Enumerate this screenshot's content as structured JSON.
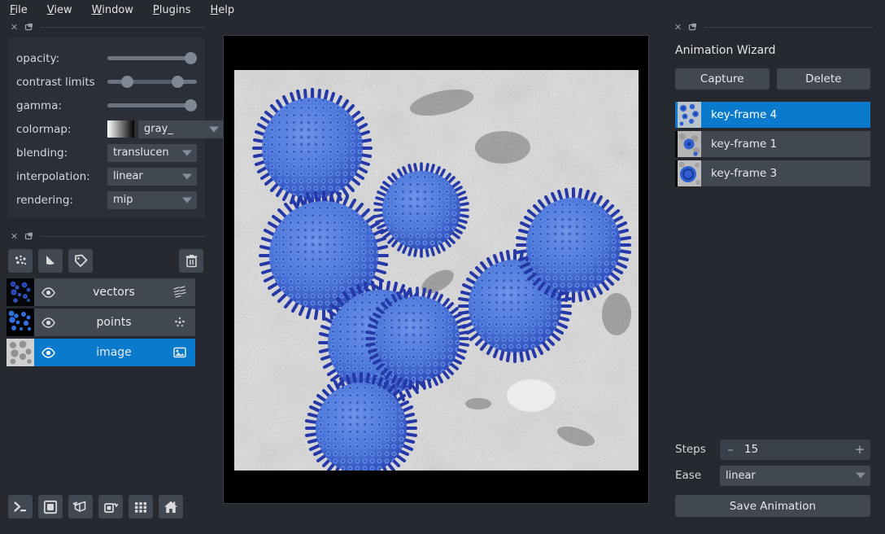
{
  "menubar": {
    "items": [
      {
        "label": "File",
        "mnemonic": "F"
      },
      {
        "label": "View",
        "mnemonic": "V"
      },
      {
        "label": "Window",
        "mnemonic": "W"
      },
      {
        "label": "Plugins",
        "mnemonic": "P"
      },
      {
        "label": "Help",
        "mnemonic": "H"
      }
    ]
  },
  "layer_controls": {
    "rows": [
      {
        "label": "opacity:",
        "kind": "slider",
        "value": 100
      },
      {
        "label": "contrast limits",
        "kind": "range",
        "low": 22,
        "high": 82
      },
      {
        "label": "gamma:",
        "kind": "slider",
        "value": 100
      },
      {
        "label": "colormap:",
        "kind": "colormap",
        "value": "gray_"
      },
      {
        "label": "blending:",
        "kind": "select",
        "value": "translucen"
      },
      {
        "label": "interpolation:",
        "kind": "select",
        "value": "linear"
      },
      {
        "label": "rendering:",
        "kind": "select",
        "value": "mip"
      }
    ],
    "colormap_swatch_from": "#ffffff",
    "colormap_swatch_to": "#000000"
  },
  "layer_buttons": [
    {
      "name": "new-points-layer",
      "icon": "points-icon"
    },
    {
      "name": "new-shapes-layer",
      "icon": "shapes-icon"
    },
    {
      "name": "new-labels-layer",
      "icon": "labels-icon"
    },
    {
      "name": "delete-layer",
      "icon": "trash-icon"
    }
  ],
  "layers": [
    {
      "name": "vectors",
      "type_icon": "vectors-icon",
      "visible": true,
      "selected": false
    },
    {
      "name": "points",
      "type_icon": "points-icon",
      "visible": true,
      "selected": false
    },
    {
      "name": "image",
      "type_icon": "image-icon",
      "visible": true,
      "selected": true
    }
  ],
  "viewer_buttons": [
    {
      "name": "console-button",
      "icon": "console-icon"
    },
    {
      "name": "ndisplay-toggle-button",
      "icon": "square-2d-icon"
    },
    {
      "name": "roll-dims-button",
      "icon": "cube-roll-icon"
    },
    {
      "name": "transpose-dims-button",
      "icon": "transpose-icon"
    },
    {
      "name": "grid-view-button",
      "icon": "grid-icon"
    },
    {
      "name": "home-button",
      "icon": "home-icon"
    }
  ],
  "animation_wizard": {
    "title": "Animation Wizard",
    "capture_label": "Capture",
    "delete_label": "Delete",
    "keyframes": [
      {
        "label": "key-frame 4",
        "selected": true
      },
      {
        "label": "key-frame 1",
        "selected": false
      },
      {
        "label": "key-frame 3",
        "selected": false
      }
    ],
    "steps_label": "Steps",
    "steps_value": "15",
    "steps_minus": "–",
    "steps_plus": "+",
    "ease_label": "Ease",
    "ease_value": "linear",
    "save_label": "Save Animation"
  },
  "canvas": {
    "background": "#000000",
    "description": "electron micrograph of spherical virus particles with blue points and vectors overlay"
  },
  "theme": {
    "accent": "#0a7acc",
    "background": "#262930",
    "panel": "#2b2f38",
    "control": "#414851",
    "text": "#d4d6da"
  }
}
